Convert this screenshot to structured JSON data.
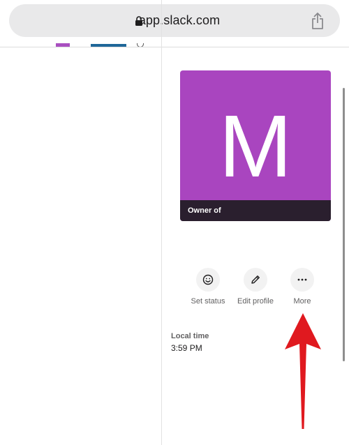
{
  "browser": {
    "url": "app.slack.com",
    "lock_icon": "lock-icon",
    "share_icon": "share-icon"
  },
  "profile": {
    "avatar_letter": "M",
    "avatar_color": "#a945bf",
    "owner_label": "Owner of"
  },
  "actions": [
    {
      "label": "Set status",
      "icon": "smiley-icon"
    },
    {
      "label": "Edit profile",
      "icon": "pencil-icon"
    },
    {
      "label": "More",
      "icon": "more-dots-icon"
    }
  ],
  "local_time": {
    "label": "Local time",
    "value": "3:59 PM"
  },
  "annotation": {
    "arrow_color": "#e0191f",
    "icon": "red-arrow-icon"
  }
}
